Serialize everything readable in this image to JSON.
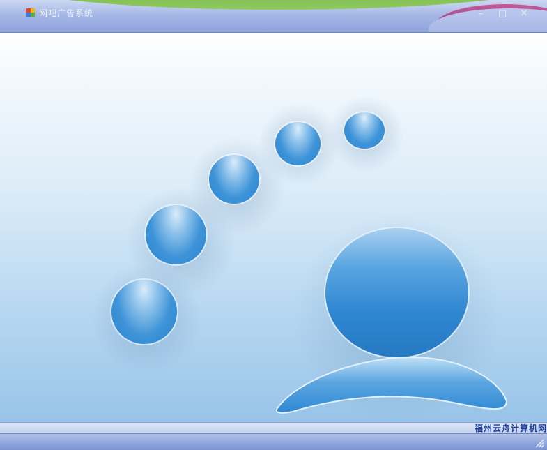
{
  "window": {
    "title": "网吧广告系统",
    "app_icon": "windows-flag-icon",
    "minimize_icon": "minimize-icon",
    "maximize_icon": "maximize-icon",
    "close_icon": "close-icon",
    "minimize_glyph": "–",
    "maximize_glyph": "□",
    "close_glyph": "✕"
  },
  "content": {
    "logo_icon": "person-with-dots-logo-icon"
  },
  "statusbar": {
    "text": "福州云舟计算机网",
    "grip_icon": "resize-grip-icon"
  },
  "colors": {
    "titlebar": "#97abe0",
    "accent_blue": "#2f87d2",
    "status_text": "#1e3f96"
  }
}
